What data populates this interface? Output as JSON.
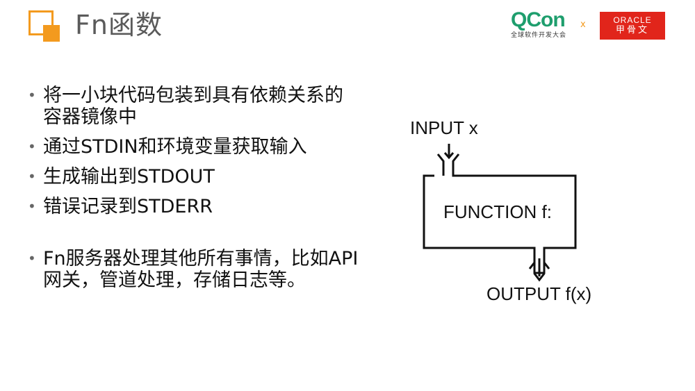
{
  "header": {
    "title": "Fn函数",
    "qcon_brand": "QCon",
    "qcon_tagline": "全球软件开发大会",
    "separator": "x",
    "oracle_brand_en": "ORACLE",
    "oracle_brand_zh": "甲骨文",
    "accent_color": "#f39a1e",
    "oracle_color": "#e1251b"
  },
  "bullets": [
    {
      "text": "将一小块代码包装到具有依赖关系的容器镜像中"
    },
    {
      "text": "通过STDIN和环境变量获取输入"
    },
    {
      "text": "生成输出到STDOUT"
    },
    {
      "text": "错误记录到STDERR"
    },
    {
      "text": "Fn服务器处理其他所有事情，比如API网关，管道处理，存储日志等。"
    }
  ],
  "diagram": {
    "input_label": "INPUT x",
    "function_label": "FUNCTION f:",
    "output_label": "OUTPUT f(x)"
  }
}
